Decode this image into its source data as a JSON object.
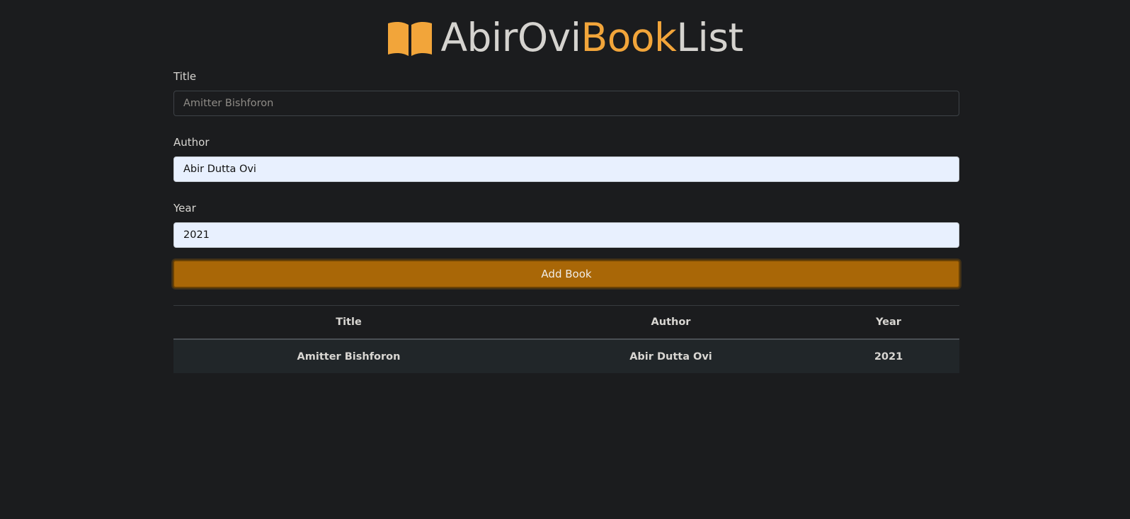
{
  "header": {
    "icon": "open-book-icon",
    "brand_main": "AbirOvi ",
    "brand_accent": "Book",
    "brand_tail": "List",
    "accent_color": "#f2a53a"
  },
  "form": {
    "title_label": "Title",
    "title_placeholder": "Amitter Bishforon",
    "title_value": "",
    "author_label": "Author",
    "author_value": "Abir Dutta Ovi",
    "year_label": "Year",
    "year_value": "2021",
    "submit_label": "Add Book",
    "button_color": "#a96707"
  },
  "table": {
    "columns": [
      "Title",
      "Author",
      "Year"
    ],
    "rows": [
      [
        "Amitter Bishforon",
        "Abir Dutta Ovi",
        "2021"
      ]
    ]
  }
}
